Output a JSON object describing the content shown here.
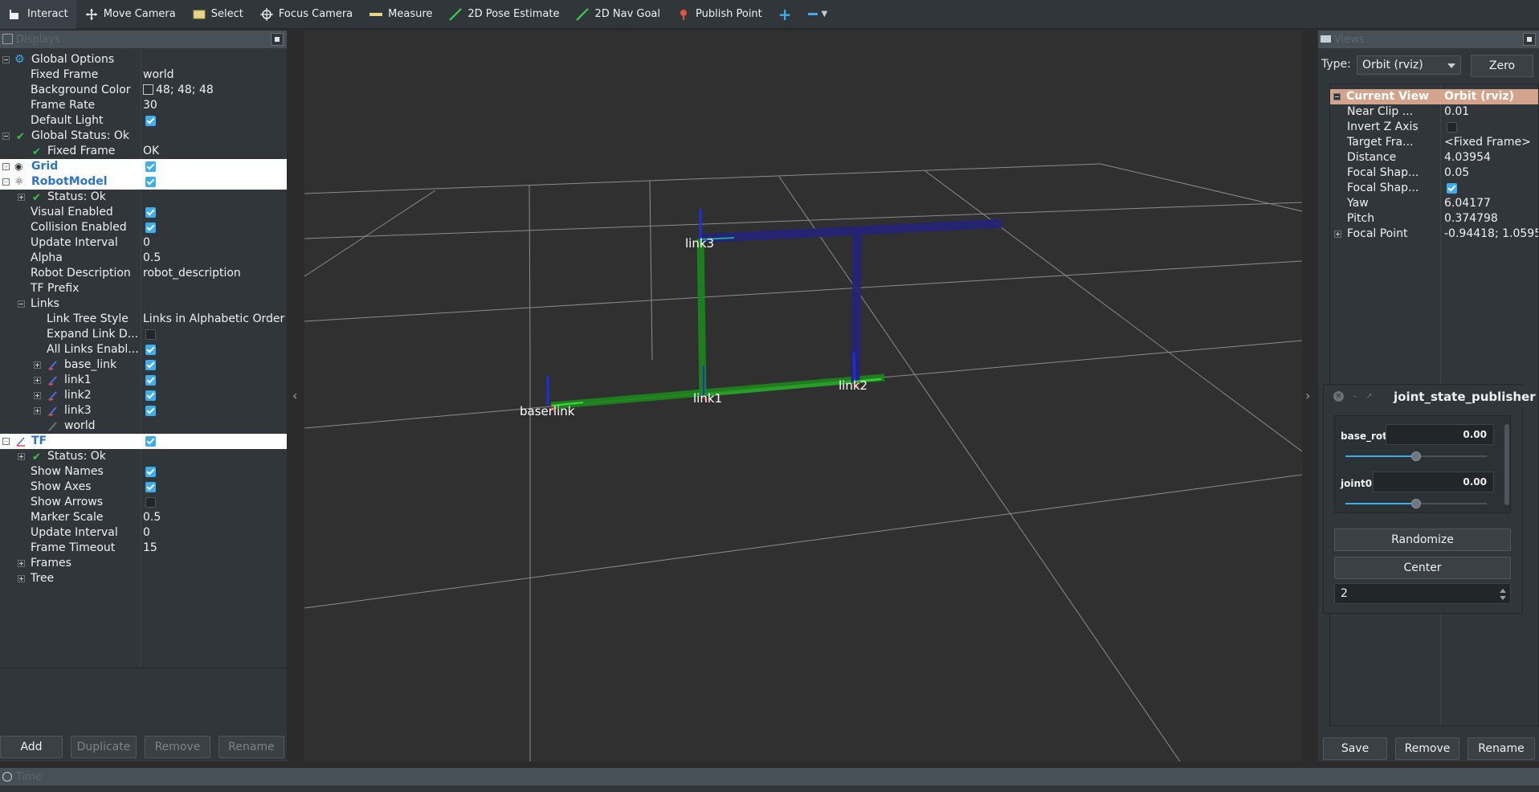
{
  "toolbar": {
    "tools": [
      {
        "label": "Interact",
        "icon": "interact-icon"
      },
      {
        "label": "Move Camera",
        "icon": "move-camera-icon"
      },
      {
        "label": "Select",
        "icon": "select-icon"
      },
      {
        "label": "Focus Camera",
        "icon": "focus-camera-icon"
      },
      {
        "label": "Measure",
        "icon": "measure-icon"
      },
      {
        "label": "2D Pose Estimate",
        "icon": "pose-estimate-icon"
      },
      {
        "label": "2D Nav Goal",
        "icon": "nav-goal-icon"
      },
      {
        "label": "Publish Point",
        "icon": "publish-point-icon"
      }
    ],
    "active_tool": "Interact"
  },
  "displays": {
    "title": "Displays",
    "global_options": "Global Options",
    "fixed_frame_label": "Fixed Frame",
    "fixed_frame_value": "world",
    "background_color_label": "Background Color",
    "background_color_value": "48; 48; 48",
    "frame_rate_label": "Frame Rate",
    "frame_rate_value": "30",
    "default_light_label": "Default Light",
    "global_status": "Global Status: Ok",
    "gs_fixed_frame_label": "Fixed Frame",
    "gs_fixed_frame_value": "OK",
    "grid": "Grid",
    "robot_model": "RobotModel",
    "rm_status": "Status: Ok",
    "visual_enabled": "Visual Enabled",
    "collision_enabled": "Collision Enabled",
    "rm_update_interval_label": "Update Interval",
    "rm_update_interval_value": "0",
    "alpha_label": "Alpha",
    "alpha_value": "0.5",
    "robot_description_label": "Robot Description",
    "robot_description_value": "robot_description",
    "tf_prefix": "TF Prefix",
    "links": "Links",
    "link_tree_style_label": "Link Tree Style",
    "link_tree_style_value": "Links in Alphabetic Order",
    "expand_link": "Expand Link D...",
    "all_links": "All Links Enabl...",
    "link_items": [
      "base_link",
      "link1",
      "link2",
      "link3",
      "world"
    ],
    "tf": "TF",
    "tf_status": "Status: Ok",
    "show_names": "Show Names",
    "show_axes": "Show Axes",
    "show_arrows": "Show Arrows",
    "marker_scale_label": "Marker Scale",
    "marker_scale_value": "0.5",
    "tf_update_interval_label": "Update Interval",
    "tf_update_interval_value": "0",
    "frame_timeout_label": "Frame Timeout",
    "frame_timeout_value": "15",
    "frames": "Frames",
    "tree": "Tree",
    "buttons": {
      "add": "Add",
      "duplicate": "Duplicate",
      "remove": "Remove",
      "rename": "Rename"
    }
  },
  "viewport": {
    "frame_labels": {
      "base": "baserlink",
      "link1": "link1",
      "link2": "link2",
      "link3": "link3"
    },
    "background_color": "#303030"
  },
  "views": {
    "title": "Views",
    "type_label": "Type:",
    "type_value": "Orbit (rviz)",
    "zero_button": "Zero",
    "current_view_label": "Current View",
    "current_view_value": "Orbit (rviz)",
    "props": [
      {
        "label": "Near Clip ...",
        "value": "0.01"
      },
      {
        "label": "Invert Z Axis",
        "value": ""
      },
      {
        "label": "Target Fra...",
        "value": "<Fixed Frame>"
      },
      {
        "label": "Distance",
        "value": "4.03954"
      },
      {
        "label": "Focal Shap...",
        "value": "0.05"
      },
      {
        "label": "Focal Shap...",
        "value": ""
      },
      {
        "label": "Yaw",
        "value": "6.04177"
      },
      {
        "label": "Pitch",
        "value": "0.374798"
      },
      {
        "label": "Focal Point",
        "value": "-0.94418; 1.0595..."
      }
    ],
    "buttons": {
      "save": "Save",
      "remove": "Remove",
      "rename": "Rename"
    }
  },
  "joint_state_publisher": {
    "title": "joint_state_publisher",
    "joints": [
      {
        "name": "base_rot",
        "value": "0.00",
        "position": 0.5
      },
      {
        "name": "joint0",
        "value": "0.00",
        "position": 0.5
      }
    ],
    "randomize": "Randomize",
    "center": "Center",
    "spin_value": "2"
  },
  "time": {
    "title": "Time"
  }
}
